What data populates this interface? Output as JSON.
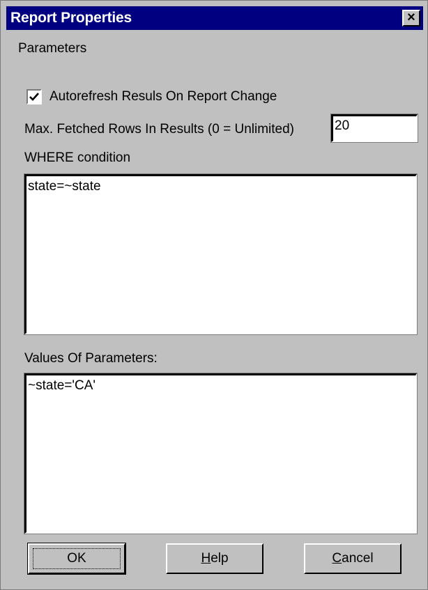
{
  "window": {
    "title": "Report Properties",
    "close_glyph": "×"
  },
  "tab_label": "Parameters",
  "autorefresh": {
    "label": "Autorefresh Resuls On Report Change",
    "checked": true
  },
  "max_rows": {
    "label": "Max. Fetched Rows In Results (0 = Unlimited)",
    "value": "20"
  },
  "where": {
    "label": "WHERE condition",
    "value": "state=~state"
  },
  "params": {
    "label": "Values Of Parameters:",
    "value": "~state='CA'"
  },
  "buttons": {
    "ok": "OK",
    "help_mnemonic": "H",
    "help_rest": "elp",
    "cancel_mnemonic": "C",
    "cancel_rest": "ancel"
  }
}
